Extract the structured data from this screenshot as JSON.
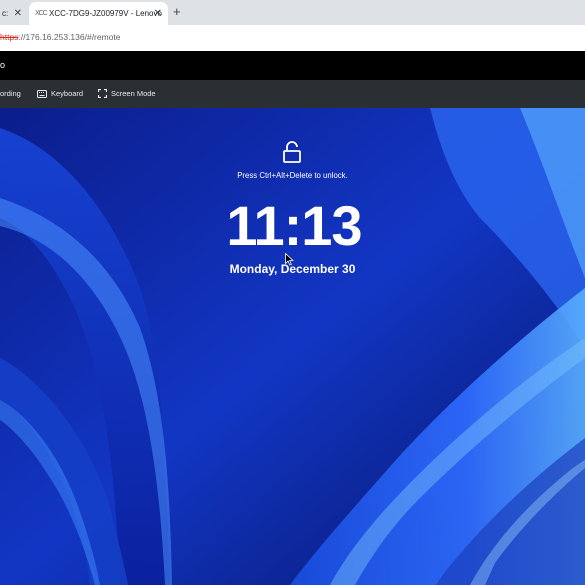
{
  "browser": {
    "tabs": [
      {
        "title": "c:",
        "active": false
      },
      {
        "title": "XCC-7DG9-JZ00979V - Lenovo",
        "active": true
      }
    ],
    "favicon_text": "XCC",
    "close_glyph": "✕",
    "new_tab_glyph": "+",
    "url_protocol": "https",
    "url_rest": "://176.16.253.136/#/remote"
  },
  "app": {
    "header_label": "o"
  },
  "toolbar": {
    "items": [
      {
        "label": "ording",
        "icon": "record-icon"
      },
      {
        "label": "Keyboard",
        "icon": "keyboard-icon"
      },
      {
        "label": "Screen Mode",
        "icon": "fullscreen-icon"
      }
    ]
  },
  "lockscreen": {
    "hint": "Press Ctrl+Alt+Delete to unlock.",
    "time": "11:13",
    "date": "Monday, December 30",
    "icon": "unlock-icon"
  },
  "colors": {
    "tabstrip": "#dee1e6",
    "toolbar": "#2a2f34",
    "wallpaper_dark": "#0a1a7a",
    "wallpaper_light": "#3a8cff"
  }
}
